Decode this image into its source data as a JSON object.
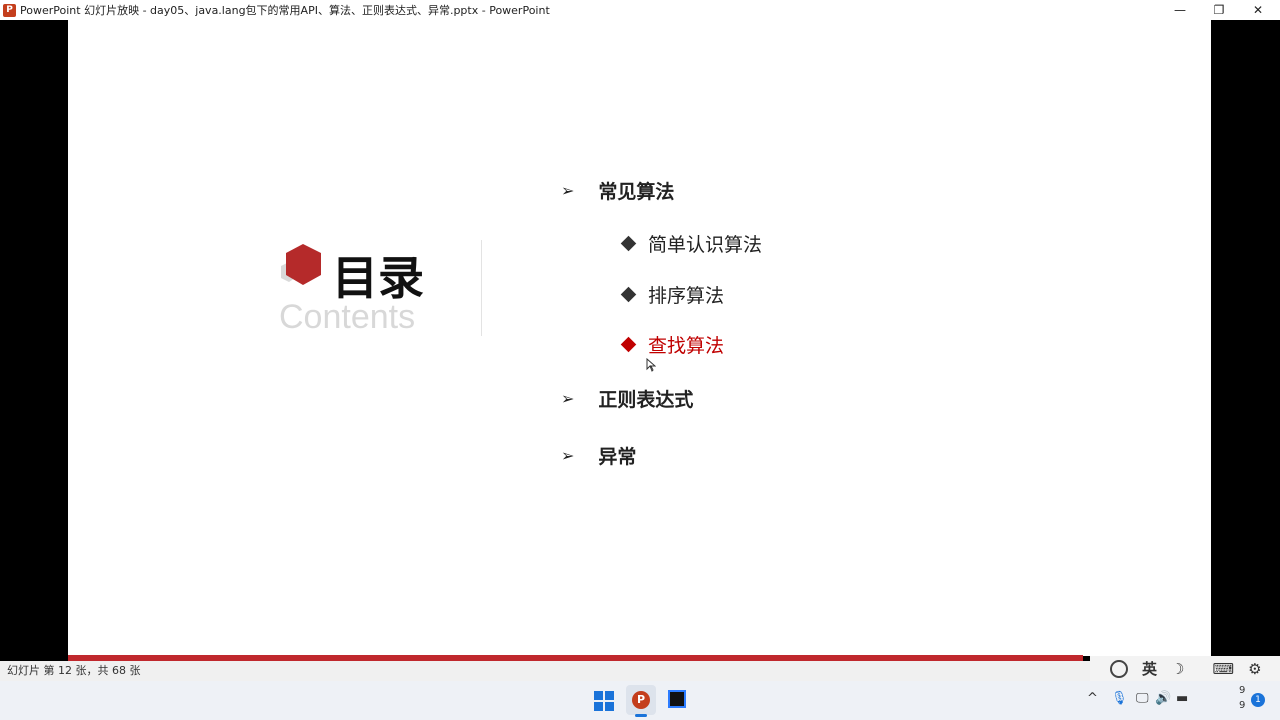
{
  "window": {
    "title": "PowerPoint 幻灯片放映  -  day05、java.lang包下的常用API、算法、正则表达式、异常.pptx - PowerPoint",
    "app_icon": "P",
    "minimize": "—",
    "restore": "❐",
    "close": "✕"
  },
  "slide": {
    "title": "目录",
    "subtitle": "Contents",
    "items": [
      {
        "label": "常见算法",
        "level": 1
      },
      {
        "label": "简单认识算法",
        "level": 2
      },
      {
        "label": "排序算法",
        "level": 2
      },
      {
        "label": "查找算法",
        "level": 2,
        "highlight": true
      },
      {
        "label": "正则表达式",
        "level": 1
      },
      {
        "label": "异常",
        "level": 1
      }
    ],
    "arrow": "➢",
    "accent": "#c00000"
  },
  "status": {
    "text": "幻灯片 第 12 张，共 68 张"
  },
  "ime": {
    "lang": "英",
    "moon": "☽",
    "gear": "⚙",
    "keyboard": "⌨"
  },
  "tray": {
    "chevron": "^",
    "time_line1": "9",
    "time_line2": "9",
    "notifications": "1"
  }
}
